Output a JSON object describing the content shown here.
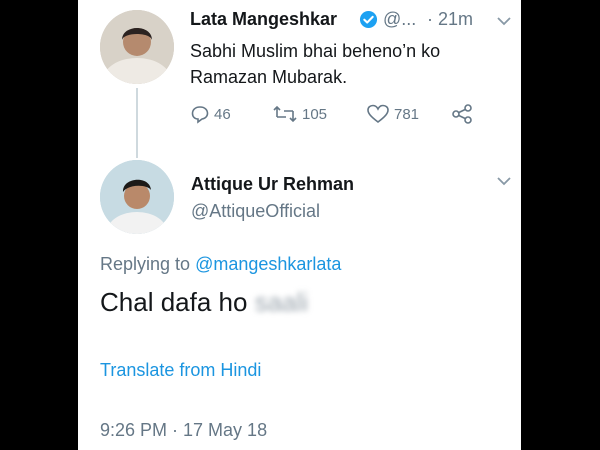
{
  "original_tweet": {
    "name": "Lata Mangeshkar",
    "handle": "@...",
    "time": "· 21m",
    "text": "Sabhi Muslim bhai beheno’n ko Ramazan Mubarak.",
    "replies": "46",
    "retweets": "105",
    "likes": "781",
    "verified": true
  },
  "reply_tweet": {
    "name": "Attique Ur Rehman",
    "handle": "@AttiqueOfficial",
    "replying_prefix": "Replying to",
    "replying_to": "@mangeshkarlata",
    "text": "Chal dafa ho",
    "blurred_word": "saali",
    "translate_label": "Translate from Hindi",
    "timestamp": "9:26 PM · 17 May 18"
  },
  "colors": {
    "link": "#1b95e0",
    "muted": "#657786",
    "verified": "#1da1f2"
  },
  "icons": [
    "chevron-down-icon",
    "verified-badge-icon",
    "reply-icon",
    "retweet-icon",
    "like-icon",
    "share-icon"
  ]
}
